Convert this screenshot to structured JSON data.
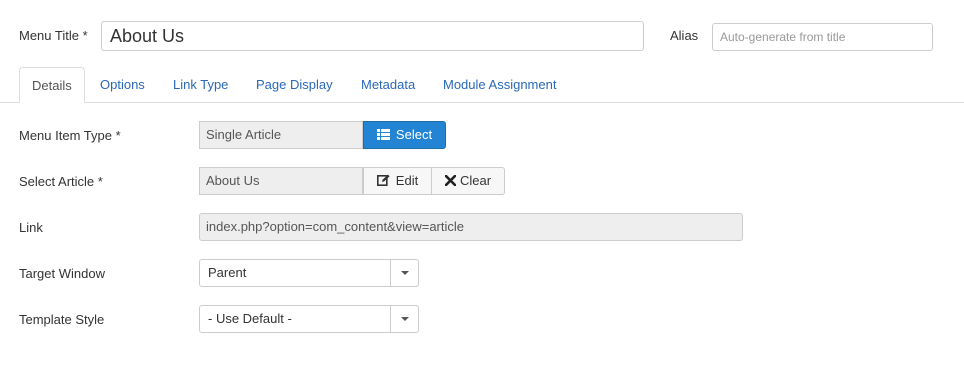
{
  "header": {
    "menu_title_label": "Menu Title *",
    "menu_title_value": "About Us",
    "alias_label": "Alias",
    "alias_placeholder": "Auto-generate from title"
  },
  "tabs": [
    {
      "label": "Details",
      "active": true
    },
    {
      "label": "Options"
    },
    {
      "label": "Link Type"
    },
    {
      "label": "Page Display"
    },
    {
      "label": "Metadata"
    },
    {
      "label": "Module Assignment"
    }
  ],
  "form": {
    "menu_item_type": {
      "label": "Menu Item Type *",
      "value": "Single Article",
      "button": "Select",
      "button_icon": "list-icon"
    },
    "select_article": {
      "label": "Select Article *",
      "value": "About Us",
      "edit_button": "Edit",
      "edit_icon": "edit-icon",
      "clear_button": "Clear",
      "clear_icon": "close-icon"
    },
    "link": {
      "label": "Link",
      "value": "index.php?option=com_content&view=article"
    },
    "target_window": {
      "label": "Target Window",
      "value": "Parent"
    },
    "template_style": {
      "label": "Template Style",
      "value": "- Use Default -"
    }
  },
  "colors": {
    "accent": "#2384d3",
    "link": "#2a69b8"
  }
}
